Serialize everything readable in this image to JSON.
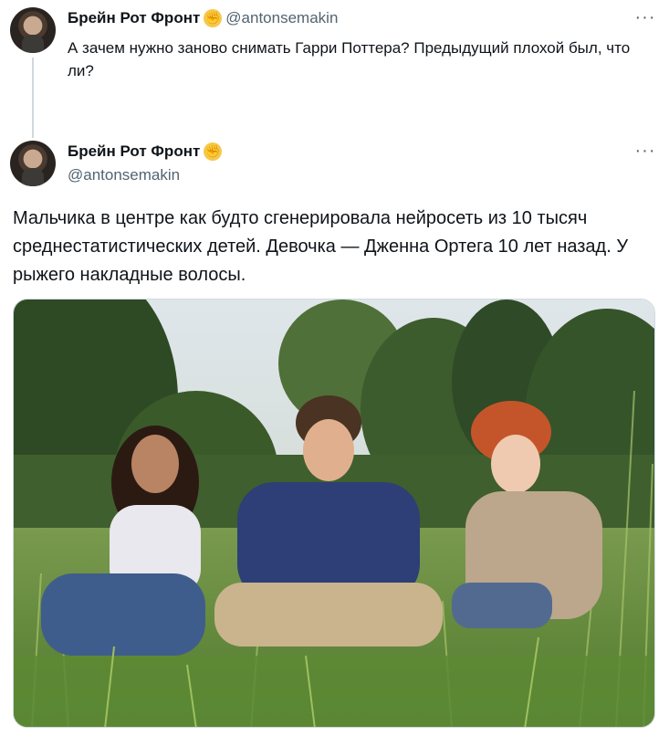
{
  "reply_tweet": {
    "display_name": "Брейн Рот Фронт",
    "handle": "@antonsemakin",
    "text": "А зачем нужно заново снимать Гарри Поттера? Предыдущий плохой был, что ли?",
    "badge_icon": "raised-fist-icon"
  },
  "main_tweet": {
    "display_name": "Брейн Рот Фронт",
    "handle": "@antonsemakin",
    "text": "Мальчика в центре как будто сгенерировала нейросеть из 10 тысяч среднестатистических детей. Девочка — Дженна Ортега 10 лет назад. У рыжего накладные волосы.",
    "badge_icon": "raised-fist-icon"
  },
  "more_label": "···",
  "colors": {
    "text": "#0f1419",
    "secondary": "#536471",
    "thread_line": "#cfd9de",
    "badge": "#f5c84a"
  }
}
